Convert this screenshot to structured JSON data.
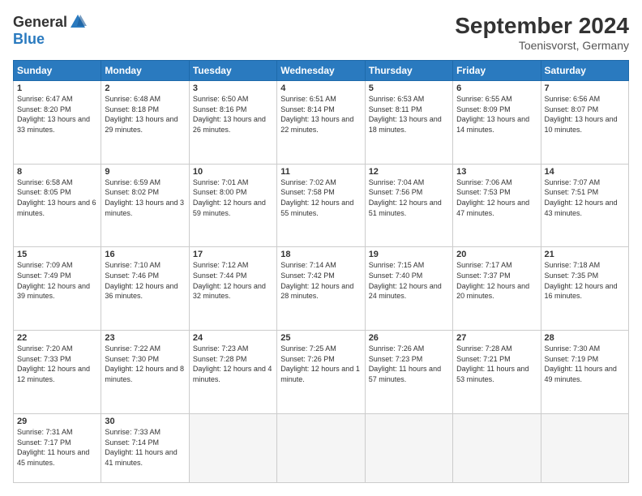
{
  "logo": {
    "general": "General",
    "blue": "Blue"
  },
  "header": {
    "title": "September 2024",
    "location": "Toenisvorst, Germany"
  },
  "columns": [
    "Sunday",
    "Monday",
    "Tuesday",
    "Wednesday",
    "Thursday",
    "Friday",
    "Saturday"
  ],
  "weeks": [
    [
      {
        "day": "1",
        "sunrise": "6:47 AM",
        "sunset": "8:20 PM",
        "daylight": "13 hours and 33 minutes."
      },
      {
        "day": "2",
        "sunrise": "6:48 AM",
        "sunset": "8:18 PM",
        "daylight": "13 hours and 29 minutes."
      },
      {
        "day": "3",
        "sunrise": "6:50 AM",
        "sunset": "8:16 PM",
        "daylight": "13 hours and 26 minutes."
      },
      {
        "day": "4",
        "sunrise": "6:51 AM",
        "sunset": "8:14 PM",
        "daylight": "13 hours and 22 minutes."
      },
      {
        "day": "5",
        "sunrise": "6:53 AM",
        "sunset": "8:11 PM",
        "daylight": "13 hours and 18 minutes."
      },
      {
        "day": "6",
        "sunrise": "6:55 AM",
        "sunset": "8:09 PM",
        "daylight": "13 hours and 14 minutes."
      },
      {
        "day": "7",
        "sunrise": "6:56 AM",
        "sunset": "8:07 PM",
        "daylight": "13 hours and 10 minutes."
      }
    ],
    [
      {
        "day": "8",
        "sunrise": "6:58 AM",
        "sunset": "8:05 PM",
        "daylight": "13 hours and 6 minutes."
      },
      {
        "day": "9",
        "sunrise": "6:59 AM",
        "sunset": "8:02 PM",
        "daylight": "13 hours and 3 minutes."
      },
      {
        "day": "10",
        "sunrise": "7:01 AM",
        "sunset": "8:00 PM",
        "daylight": "12 hours and 59 minutes."
      },
      {
        "day": "11",
        "sunrise": "7:02 AM",
        "sunset": "7:58 PM",
        "daylight": "12 hours and 55 minutes."
      },
      {
        "day": "12",
        "sunrise": "7:04 AM",
        "sunset": "7:56 PM",
        "daylight": "12 hours and 51 minutes."
      },
      {
        "day": "13",
        "sunrise": "7:06 AM",
        "sunset": "7:53 PM",
        "daylight": "12 hours and 47 minutes."
      },
      {
        "day": "14",
        "sunrise": "7:07 AM",
        "sunset": "7:51 PM",
        "daylight": "12 hours and 43 minutes."
      }
    ],
    [
      {
        "day": "15",
        "sunrise": "7:09 AM",
        "sunset": "7:49 PM",
        "daylight": "12 hours and 39 minutes."
      },
      {
        "day": "16",
        "sunrise": "7:10 AM",
        "sunset": "7:46 PM",
        "daylight": "12 hours and 36 minutes."
      },
      {
        "day": "17",
        "sunrise": "7:12 AM",
        "sunset": "7:44 PM",
        "daylight": "12 hours and 32 minutes."
      },
      {
        "day": "18",
        "sunrise": "7:14 AM",
        "sunset": "7:42 PM",
        "daylight": "12 hours and 28 minutes."
      },
      {
        "day": "19",
        "sunrise": "7:15 AM",
        "sunset": "7:40 PM",
        "daylight": "12 hours and 24 minutes."
      },
      {
        "day": "20",
        "sunrise": "7:17 AM",
        "sunset": "7:37 PM",
        "daylight": "12 hours and 20 minutes."
      },
      {
        "day": "21",
        "sunrise": "7:18 AM",
        "sunset": "7:35 PM",
        "daylight": "12 hours and 16 minutes."
      }
    ],
    [
      {
        "day": "22",
        "sunrise": "7:20 AM",
        "sunset": "7:33 PM",
        "daylight": "12 hours and 12 minutes."
      },
      {
        "day": "23",
        "sunrise": "7:22 AM",
        "sunset": "7:30 PM",
        "daylight": "12 hours and 8 minutes."
      },
      {
        "day": "24",
        "sunrise": "7:23 AM",
        "sunset": "7:28 PM",
        "daylight": "12 hours and 4 minutes."
      },
      {
        "day": "25",
        "sunrise": "7:25 AM",
        "sunset": "7:26 PM",
        "daylight": "12 hours and 1 minute."
      },
      {
        "day": "26",
        "sunrise": "7:26 AM",
        "sunset": "7:23 PM",
        "daylight": "11 hours and 57 minutes."
      },
      {
        "day": "27",
        "sunrise": "7:28 AM",
        "sunset": "7:21 PM",
        "daylight": "11 hours and 53 minutes."
      },
      {
        "day": "28",
        "sunrise": "7:30 AM",
        "sunset": "7:19 PM",
        "daylight": "11 hours and 49 minutes."
      }
    ],
    [
      {
        "day": "29",
        "sunrise": "7:31 AM",
        "sunset": "7:17 PM",
        "daylight": "11 hours and 45 minutes."
      },
      {
        "day": "30",
        "sunrise": "7:33 AM",
        "sunset": "7:14 PM",
        "daylight": "11 hours and 41 minutes."
      },
      null,
      null,
      null,
      null,
      null
    ]
  ]
}
